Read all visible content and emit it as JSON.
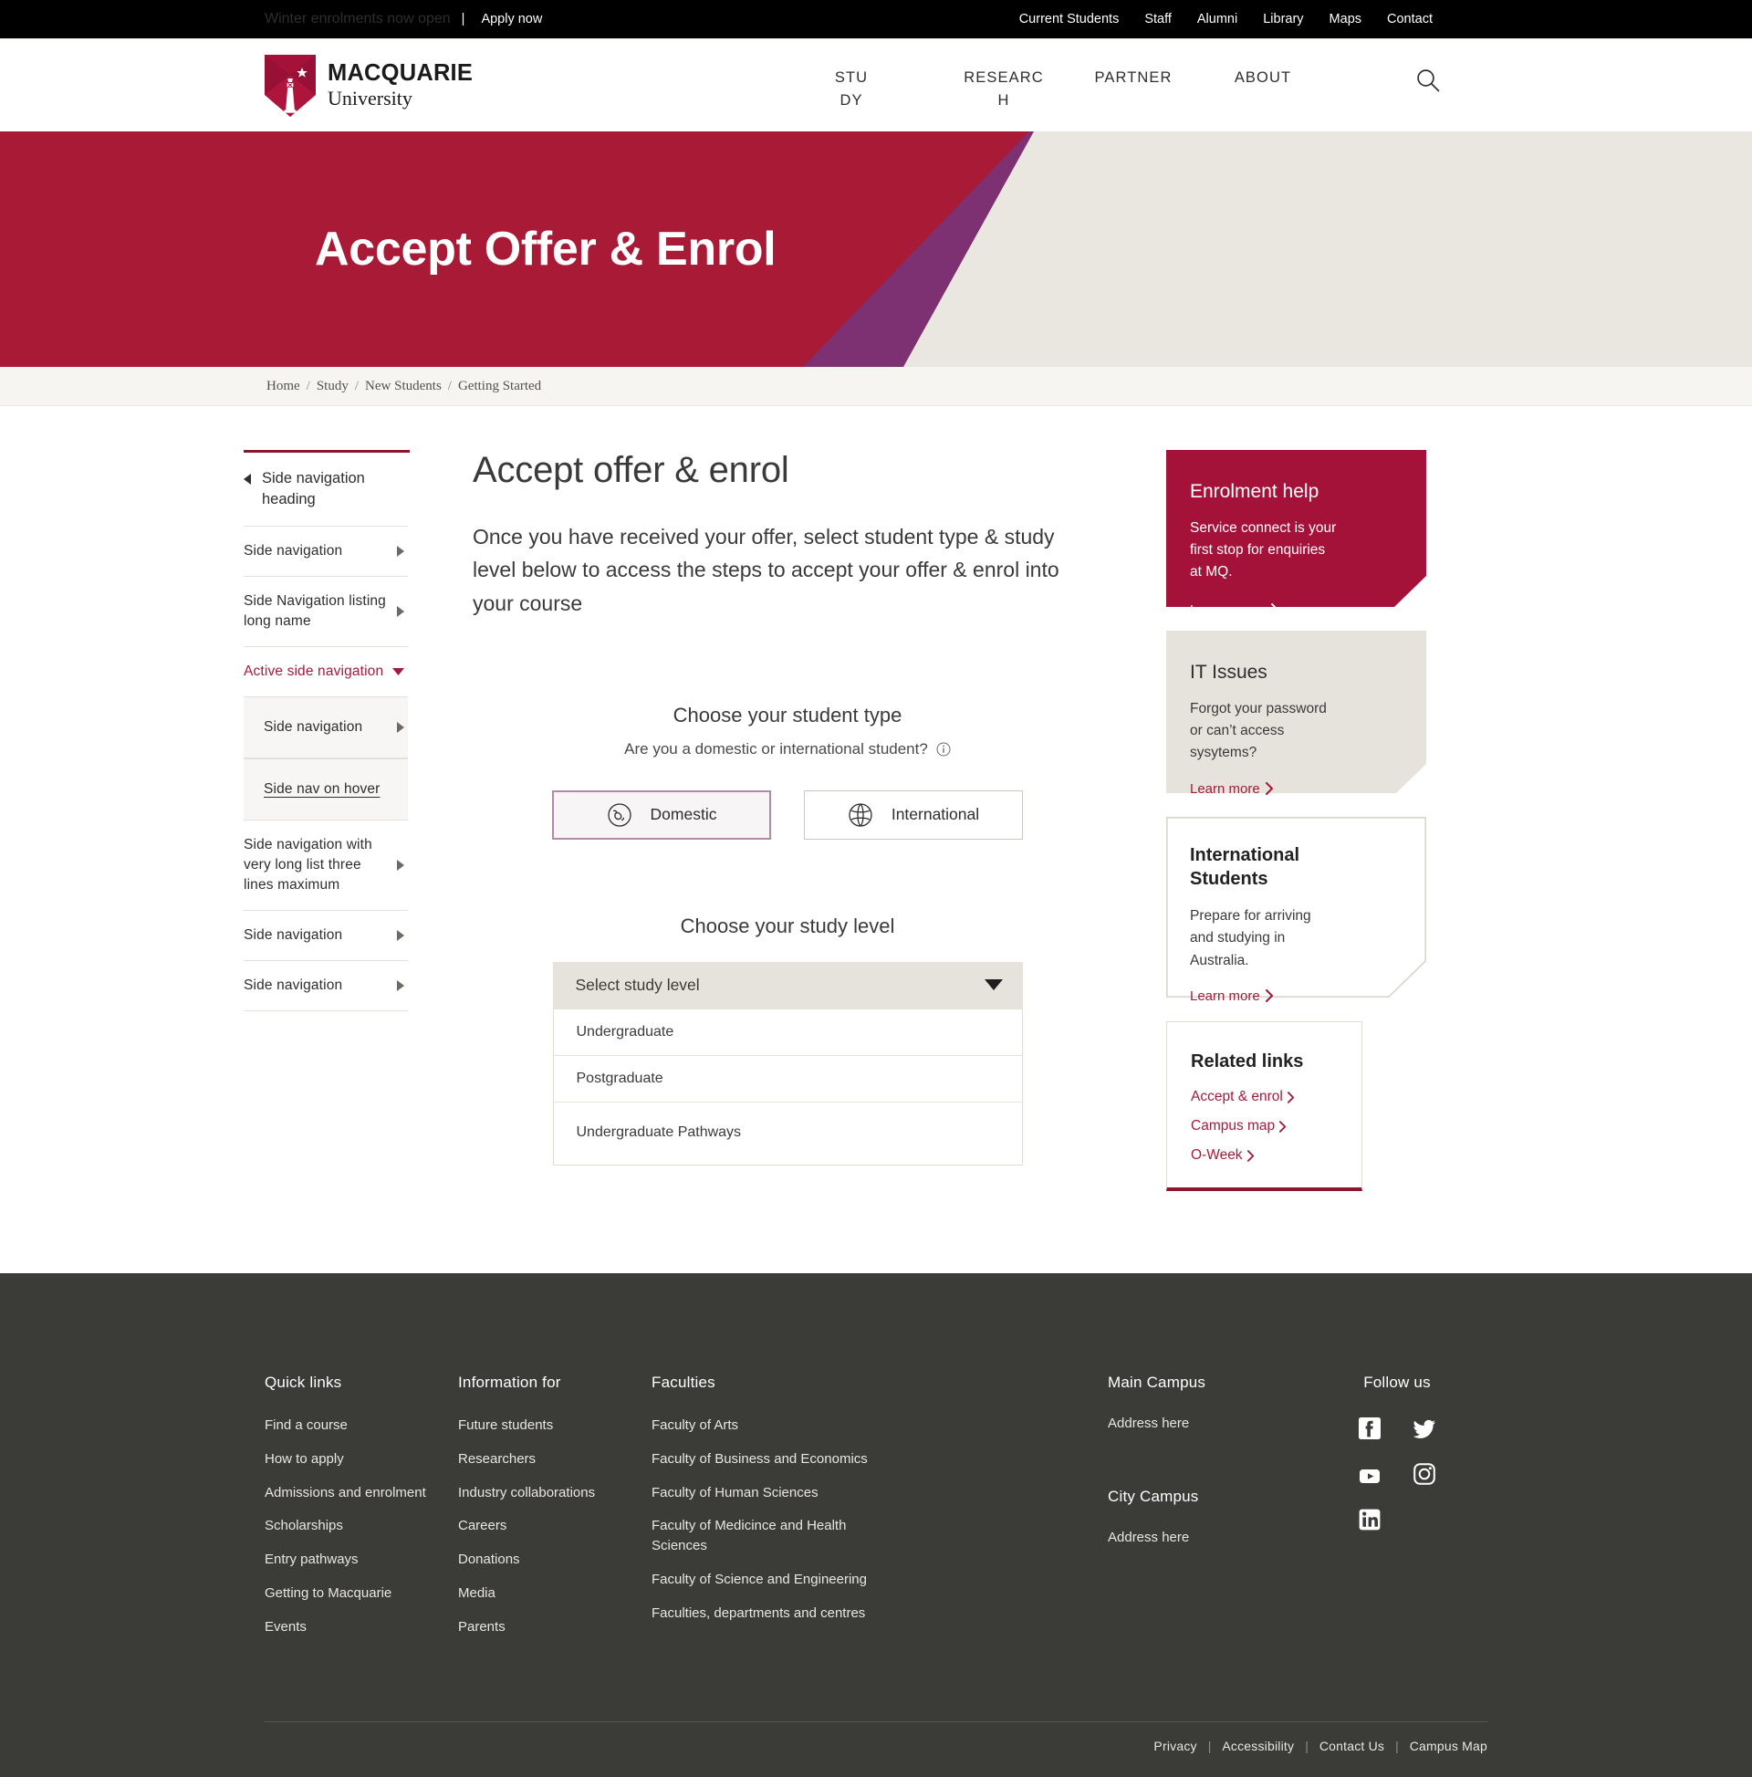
{
  "utility_bar": {
    "promo": "Winter enrolments now open",
    "separator": "|",
    "apply": "Apply now",
    "links": [
      "Current Students",
      "Staff",
      "Alumni",
      "Library",
      "Maps",
      "Contact"
    ]
  },
  "header": {
    "logo": {
      "line1": "MACQUARIE",
      "line2": "University",
      "icon": "macquarie-shield-lighthouse-logo"
    },
    "nav": [
      "STUDY",
      "RESEARCH",
      "PARTNER",
      "ABOUT"
    ],
    "search_icon": "search-icon"
  },
  "hero": {
    "title": "Accept Offer & Enrol",
    "colors": {
      "red": "#a81a36",
      "purple": "#7d3072",
      "beige": "#eae7e0"
    }
  },
  "breadcrumb": {
    "items": [
      "Home",
      "Study",
      "New Students",
      "Getting Started"
    ],
    "separator": "/"
  },
  "sidenav": {
    "heading": "Side navigation heading",
    "back_icon": "caret-left-icon",
    "items": [
      {
        "label": "Side navigation",
        "icon": "caret-right-icon",
        "active": false
      },
      {
        "label": "Side Navigation listing long name",
        "icon": "caret-right-icon",
        "active": false
      },
      {
        "label": "Active side navigation",
        "icon": "caret-down-icon",
        "active": true
      }
    ],
    "sub_items": [
      {
        "label": "Side navigation",
        "icon": "caret-right-icon",
        "hover": false
      },
      {
        "label": "Side nav on hover",
        "icon": "",
        "hover": true
      }
    ],
    "items_after": [
      {
        "label": "Side navigation with very long list three lines maximum",
        "icon": "caret-right-icon"
      },
      {
        "label": "Side navigation",
        "icon": "caret-right-icon"
      },
      {
        "label": "Side navigation",
        "icon": "caret-right-icon"
      }
    ]
  },
  "main": {
    "title": "Accept offer & enrol",
    "intro": "Once you have received your offer, select student type & study level below to access the steps to accept your offer & enrol into your course",
    "student_type": {
      "title": "Choose your student type",
      "subtitle": "Are you a domestic or international student?",
      "info_icon": "info-circle-icon",
      "options": [
        {
          "label": "Domestic",
          "icon": "globe-australia-icon",
          "selected": true
        },
        {
          "label": "International",
          "icon": "globe-world-icon",
          "selected": false
        }
      ]
    },
    "study_level": {
      "title": "Choose your study level",
      "placeholder": "Select study level",
      "chevron_icon": "chevron-down-icon",
      "open": true,
      "options": [
        "Undergraduate",
        "Postgraduate",
        "Undergraduate Pathways"
      ]
    }
  },
  "right_cards": [
    {
      "style": "red",
      "title": "Enrolment help",
      "text": "Service connect is your first stop for enquiries at MQ.",
      "link": "Learn more",
      "link_icon": "chevron-right-icon"
    },
    {
      "style": "beige",
      "title": "IT Issues",
      "text": "Forgot your password or can’t access sysytems?",
      "link": "Learn more",
      "link_icon": "chevron-right-icon"
    },
    {
      "style": "outline",
      "title": "International Students",
      "text": "Prepare for arriving and studying in Australia.",
      "link": "Learn more",
      "link_icon": "chevron-right-icon"
    }
  ],
  "related_links": {
    "title": "Related links",
    "links": [
      {
        "label": "Accept & enrol",
        "icon": "chevron-right-icon"
      },
      {
        "label": "Campus map",
        "icon": "chevron-right-icon"
      },
      {
        "label": "O-Week",
        "icon": "chevron-right-icon"
      }
    ]
  },
  "footer": {
    "columns": [
      {
        "heading": "Quick links",
        "links": [
          "Find a course",
          "How to apply",
          "Admissions and enrolment",
          "Scholarships",
          "Entry pathways",
          "Getting to Macquarie",
          "Events"
        ]
      },
      {
        "heading": "Information for",
        "links": [
          "Future students",
          "Researchers",
          "Industry collaborations",
          "Careers",
          "Donations",
          "Media",
          "Parents"
        ]
      },
      {
        "heading": "Faculties",
        "links": [
          "Faculty of Arts",
          "Faculty of Business and Economics",
          "Faculty of Human Sciences",
          "Faculty of Medicince and Health Sciences",
          "Faculty of Science and Engineering",
          "Faculties, departments and centres"
        ]
      }
    ],
    "campuses": [
      {
        "heading": "Main Campus",
        "address": "Address here"
      },
      {
        "heading": "City Campus",
        "address": "Address here"
      }
    ],
    "social": {
      "heading": "Follow us",
      "icons": [
        "facebook-icon",
        "twitter-icon",
        "youtube-icon",
        "instagram-icon",
        "linkedin-icon"
      ]
    },
    "bottom_links": [
      "Privacy",
      "Accessibility",
      "Contact Us",
      "Campus Map"
    ],
    "bottom_separator": "|"
  }
}
